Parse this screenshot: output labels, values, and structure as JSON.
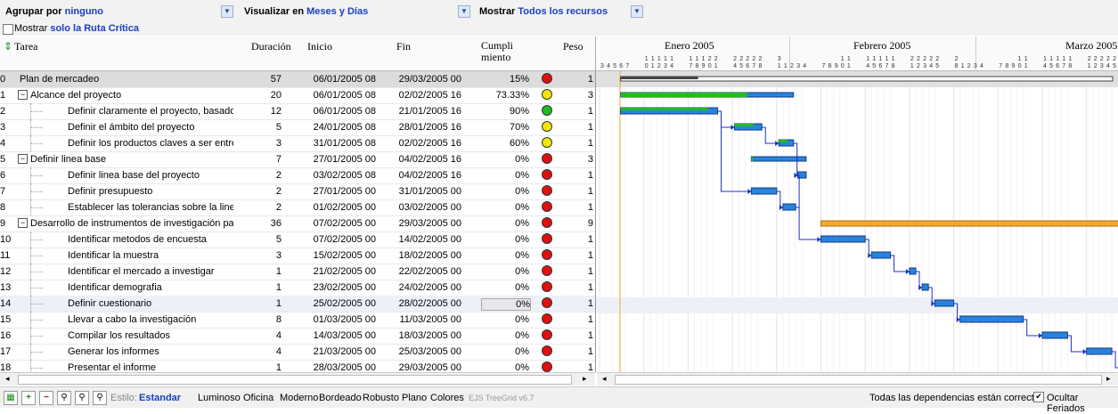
{
  "toolbar": {
    "group_label": "Agrupar por",
    "group_value": "ninguno",
    "view_label": "Visualizar en",
    "view_value": "Meses y Días",
    "show_label": "Mostrar",
    "show_value": "Todos los recursos",
    "critical_prefix": "Mostrar",
    "critical_value": "solo la Ruta Crítica"
  },
  "columns": {
    "task": "Tarea",
    "duration": "Duración",
    "start": "Inicio",
    "end": "Fin",
    "completion": "Cumpli miento",
    "weight": "Peso"
  },
  "gantt_header": {
    "months": [
      "Enero 2005",
      "Febrero 2005",
      "Marzo 2005"
    ]
  },
  "rows": [
    {
      "id": "0",
      "task": "Plan de mercadeo",
      "duration": "57",
      "start": "06/01/2005 08",
      "end": "29/03/2005 00",
      "completion": "15%",
      "weight": "1",
      "status": "red",
      "level": 0,
      "expand": ""
    },
    {
      "id": "1",
      "task": "Alcance del proyecto",
      "duration": "20",
      "start": "06/01/2005 08",
      "end": "02/02/2005 16",
      "completion": "73.33%",
      "weight": "3",
      "status": "yellow",
      "level": 1,
      "expand": "−"
    },
    {
      "id": "2",
      "task": "Definir claramente el proyecto, basado en los c",
      "duration": "12",
      "start": "06/01/2005 08",
      "end": "21/01/2005 16",
      "completion": "90%",
      "weight": "1",
      "status": "green",
      "level": 2,
      "expand": ""
    },
    {
      "id": "3",
      "task": "Definir el ámbito del proyecto",
      "duration": "5",
      "start": "24/01/2005 08",
      "end": "28/01/2005 16",
      "completion": "70%",
      "weight": "1",
      "status": "yellow",
      "level": 2,
      "expand": ""
    },
    {
      "id": "4",
      "task": "Definir los productos claves a ser entregados",
      "duration": "3",
      "start": "31/01/2005 08",
      "end": "02/02/2005 16",
      "completion": "60%",
      "weight": "1",
      "status": "yellow",
      "level": 2,
      "expand": ""
    },
    {
      "id": "5",
      "task": "Definir linea base",
      "duration": "7",
      "start": "27/01/2005 00",
      "end": "04/02/2005 16",
      "completion": "0%",
      "weight": "3",
      "status": "red",
      "level": 1,
      "expand": "−"
    },
    {
      "id": "6",
      "task": "Definir linea base del proyecto",
      "duration": "2",
      "start": "03/02/2005 08",
      "end": "04/02/2005 16",
      "completion": "0%",
      "weight": "1",
      "status": "red",
      "level": 2,
      "expand": ""
    },
    {
      "id": "7",
      "task": "Definir presupuesto",
      "duration": "2",
      "start": "27/01/2005 00",
      "end": "31/01/2005 00",
      "completion": "0%",
      "weight": "1",
      "status": "red",
      "level": 2,
      "expand": ""
    },
    {
      "id": "8",
      "task": "Establecer las tolerancias sobre la linea base",
      "duration": "2",
      "start": "01/02/2005 00",
      "end": "03/02/2005 00",
      "completion": "0%",
      "weight": "1",
      "status": "red",
      "level": 2,
      "expand": ""
    },
    {
      "id": "9",
      "task": "Desarrollo de instrumentos de investigación para el",
      "duration": "36",
      "start": "07/02/2005 00",
      "end": "29/03/2005 00",
      "completion": "0%",
      "weight": "9",
      "status": "red",
      "level": 1,
      "expand": "−"
    },
    {
      "id": "10",
      "task": "Identificar metodos de encuesta",
      "duration": "5",
      "start": "07/02/2005 00",
      "end": "14/02/2005 00",
      "completion": "0%",
      "weight": "1",
      "status": "red",
      "level": 2,
      "expand": ""
    },
    {
      "id": "11",
      "task": "Identificar la muestra",
      "duration": "3",
      "start": "15/02/2005 00",
      "end": "18/02/2005 00",
      "completion": "0%",
      "weight": "1",
      "status": "red",
      "level": 2,
      "expand": ""
    },
    {
      "id": "12",
      "task": "Identificar el mercado a investigar",
      "duration": "1",
      "start": "21/02/2005 00",
      "end": "22/02/2005 00",
      "completion": "0%",
      "weight": "1",
      "status": "red",
      "level": 2,
      "expand": ""
    },
    {
      "id": "13",
      "task": "Identificar demografia",
      "duration": "1",
      "start": "23/02/2005 00",
      "end": "24/02/2005 00",
      "completion": "0%",
      "weight": "1",
      "status": "red",
      "level": 2,
      "expand": ""
    },
    {
      "id": "14",
      "task": "Definir cuestionario",
      "duration": "1",
      "start": "25/02/2005 00",
      "end": "28/02/2005 00",
      "completion": "0%",
      "weight": "1",
      "status": "red",
      "level": 2,
      "expand": ""
    },
    {
      "id": "15",
      "task": "Llevar a cabo la investigación",
      "duration": "8",
      "start": "01/03/2005 00",
      "end": "11/03/2005 00",
      "completion": "0%",
      "weight": "1",
      "status": "red",
      "level": 2,
      "expand": ""
    },
    {
      "id": "16",
      "task": "Compilar los resultados",
      "duration": "4",
      "start": "14/03/2005 00",
      "end": "18/03/2005 00",
      "completion": "0%",
      "weight": "1",
      "status": "red",
      "level": 2,
      "expand": ""
    },
    {
      "id": "17",
      "task": "Generar los informes",
      "duration": "4",
      "start": "21/03/2005 00",
      "end": "25/03/2005 00",
      "completion": "0%",
      "weight": "1",
      "status": "red",
      "level": 2,
      "expand": ""
    },
    {
      "id": "18",
      "task": "Presentar el informe",
      "duration": "1",
      "start": "28/03/2005 00",
      "end": "29/03/2005 00",
      "completion": "0%",
      "weight": "1",
      "status": "red",
      "level": 2,
      "expand": ""
    }
  ],
  "footer": {
    "style_label": "Estilo:",
    "styles": [
      "Estandar",
      "Luminoso",
      "Oficina",
      "Moderno",
      "Bordeado",
      "Robusto",
      "Plano",
      "Colores"
    ],
    "active_style": "Estandar",
    "version": "EJS TreeGrid v6.7",
    "status": "Todas las dependencias están correctas",
    "holidays_label": "Ocultar Feriados",
    "holidays_checked": true
  },
  "colors": {
    "green": "#22bb22",
    "yellow": "#f2e600",
    "red": "#e01010",
    "bar_blue": "#2b82d9",
    "bar_orange": "#f0a830",
    "link": "#1a3fbf"
  }
}
